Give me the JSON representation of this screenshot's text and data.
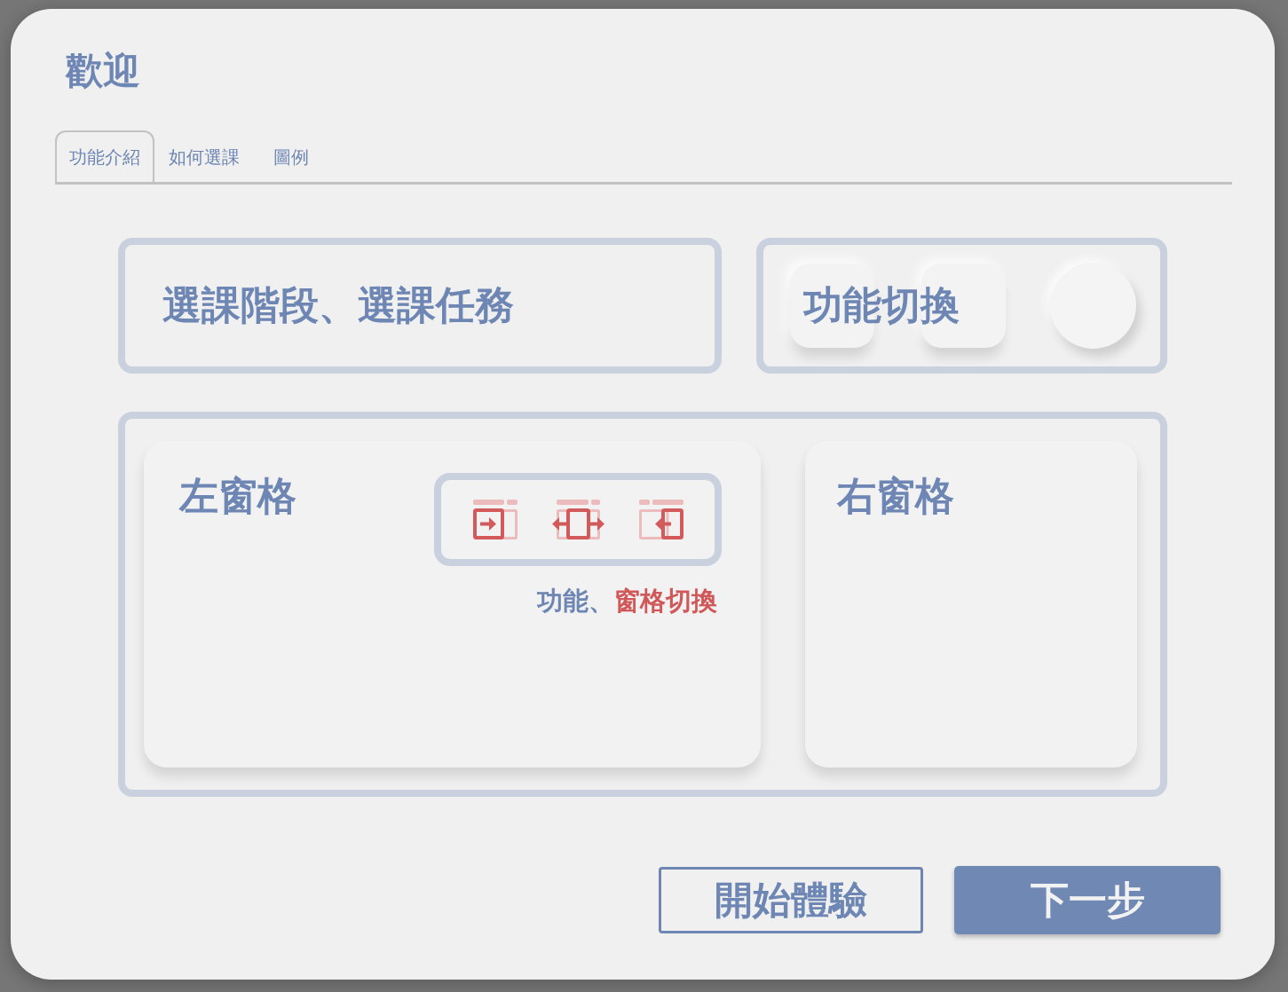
{
  "dialog": {
    "title": "歡迎"
  },
  "tabs": [
    {
      "label": "功能介紹",
      "selected": true
    },
    {
      "label": "如何選課",
      "selected": false
    },
    {
      "label": "圖例",
      "selected": false
    }
  ],
  "stage_card": {
    "label": "選課階段、選課任務"
  },
  "switch_card": {
    "label": "功能切換"
  },
  "left_pane": {
    "label": "左窗格",
    "caption": [
      {
        "text": "功能、",
        "kind": "plain"
      },
      {
        "text": "窗格切換",
        "kind": "accent"
      }
    ]
  },
  "right_pane": {
    "label": "右窗格"
  },
  "buttons": [
    {
      "label": "開始體驗",
      "kind": "outline"
    },
    {
      "label": "下一步",
      "kind": "primary"
    }
  ]
}
